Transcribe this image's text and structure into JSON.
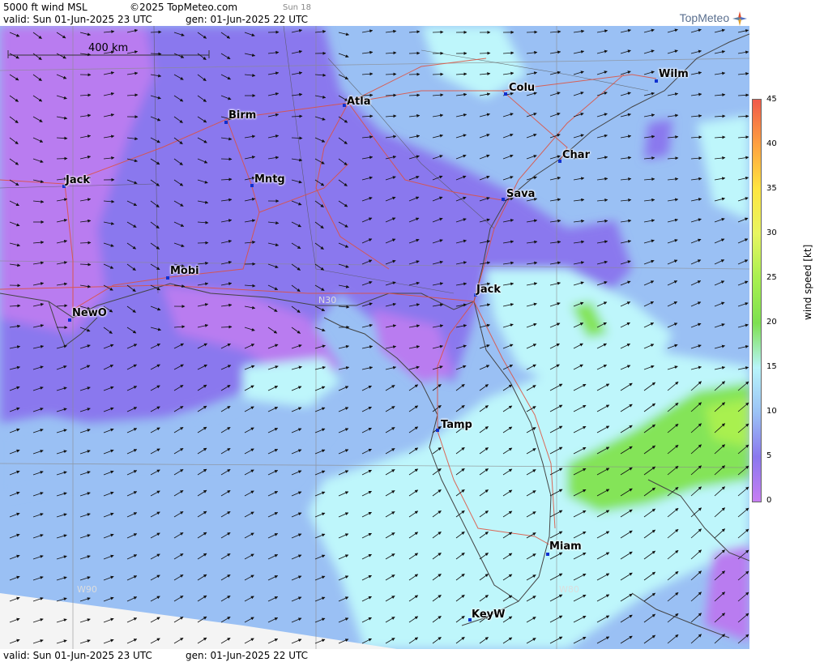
{
  "header": {
    "title": "5000 ft wind MSL",
    "copyright": "©2025 TopMeteo.com",
    "day": "Sun 18",
    "valid": "valid:  Sun  01-Jun-2025  23 UTC",
    "gen": "gen: 01-Jun-2025 22 UTC",
    "logo": "TopMeteo"
  },
  "footer": {
    "valid": "valid:  Sun  01-Jun-2025  23 UTC",
    "gen": "gen: 01-Jun-2025 22 UTC"
  },
  "scale": {
    "label": "400 km"
  },
  "grid_labels": {
    "lat": "N30",
    "lon_west": "W90",
    "lon_east": "W80"
  },
  "cities": [
    {
      "name": "Atla"
    },
    {
      "name": "Colu"
    },
    {
      "name": "Wilm"
    },
    {
      "name": "Birm"
    },
    {
      "name": "Char"
    },
    {
      "name": "Jack"
    },
    {
      "name": "Mntg"
    },
    {
      "name": "Sava"
    },
    {
      "name": "Mobi"
    },
    {
      "name": "Jack"
    },
    {
      "name": "NewO"
    },
    {
      "name": "Tamp"
    },
    {
      "name": "Miam"
    },
    {
      "name": "KeyW"
    }
  ],
  "legend": {
    "title": "wind speed [kt]",
    "ticks": [
      "45",
      "40",
      "35",
      "30",
      "25",
      "20",
      "15",
      "10",
      "5",
      "0"
    ],
    "colors": {
      "0": "#c77ef2",
      "5": "#8a78ee",
      "10": "#9bc2f5",
      "15": "#b8f5fa",
      "20": "#7ee050",
      "25": "#a9f050",
      "30": "#e8f560",
      "35": "#ffe540",
      "40": "#ffa040",
      "45": "#f05a4a"
    }
  },
  "colors": {
    "calm": "#b97cf0",
    "light": "#8c7ef0",
    "moderate": "#9ac0f4",
    "fresh": "#bef6fb",
    "strong": "#84e458",
    "roads": "#e0503c",
    "coast": "#555555"
  }
}
